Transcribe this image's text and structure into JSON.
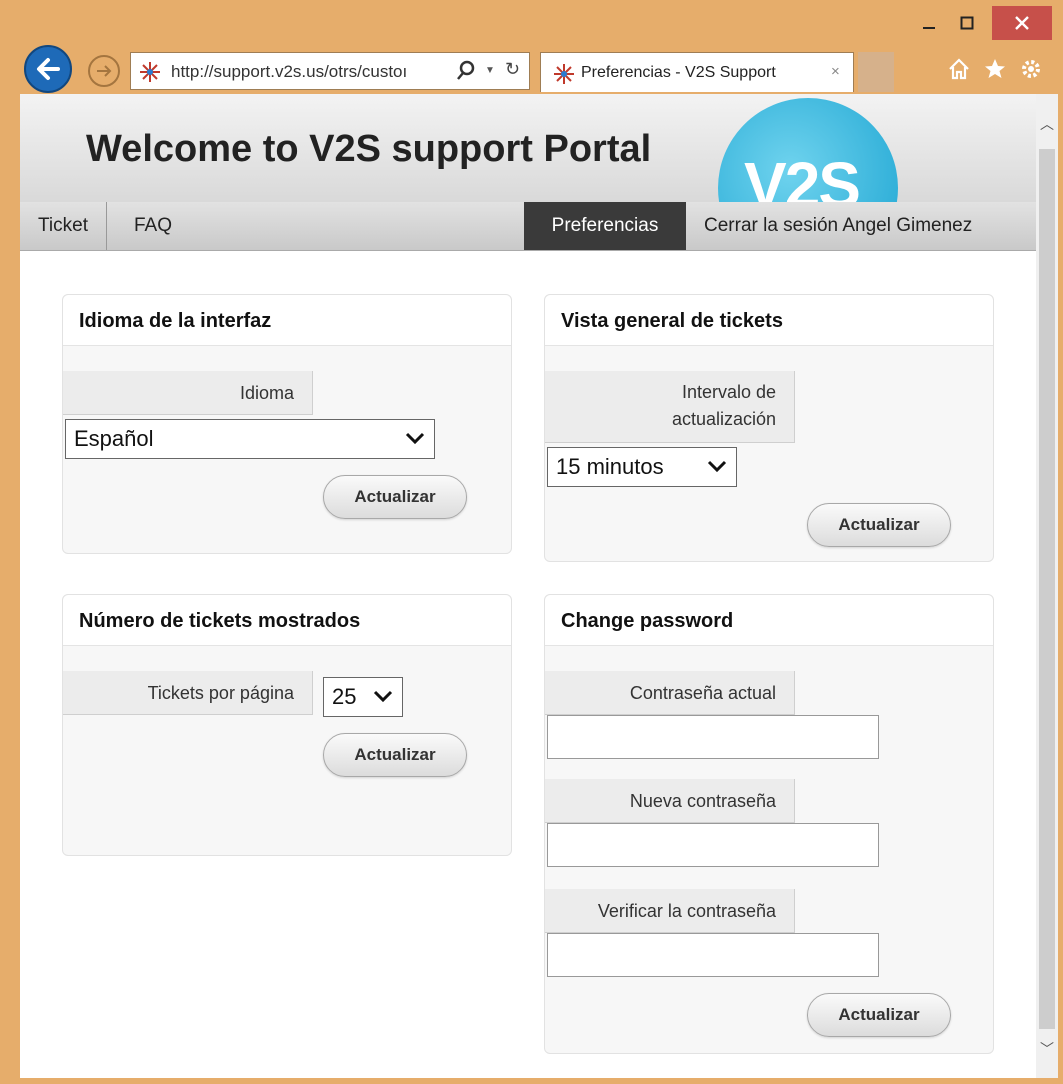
{
  "browser": {
    "url": "http://support.v2s.us/otrs/custoı",
    "tab_title": "Preferencias - V2S Support",
    "tab_close": "×",
    "minimize": "‒",
    "maximize": "□",
    "close": "✕"
  },
  "header": {
    "title": "Welcome to V2S support Portal",
    "logo_text": "V2S"
  },
  "nav": {
    "ticket": "Ticket",
    "faq": "FAQ",
    "preferences": "Preferencias",
    "logout": "Cerrar la sesión Angel Gimenez"
  },
  "language_panel": {
    "title": "Idioma de la interfaz",
    "label": "Idioma",
    "value": "Español",
    "button": "Actualizar"
  },
  "overview_panel": {
    "title": "Vista general de tickets",
    "label_line1": "Intervalo de",
    "label_line2": "actualización",
    "value": "15 minutos",
    "button": "Actualizar"
  },
  "tickets_panel": {
    "title": "Número de tickets mostrados",
    "label": "Tickets por página",
    "value": "25",
    "button": "Actualizar"
  },
  "password_panel": {
    "title": "Change password",
    "current_label": "Contraseña actual",
    "new_label": "Nueva contraseña",
    "verify_label": "Verificar la contraseña",
    "current_value": "",
    "new_value": "",
    "verify_value": "",
    "button": "Actualizar"
  },
  "icons": {
    "back": "back-arrow-icon",
    "forward": "forward-arrow-icon",
    "favicon": "v2s-favicon-icon",
    "search": "search-icon",
    "refresh": "refresh-icon",
    "home": "home-icon",
    "favorites": "star-icon",
    "settings": "gear-icon"
  },
  "colors": {
    "window_frame": "#e6ad6b",
    "close_button": "#c7504a",
    "active_nav": "#3a3a3a",
    "logo": "#1aa3d1"
  }
}
